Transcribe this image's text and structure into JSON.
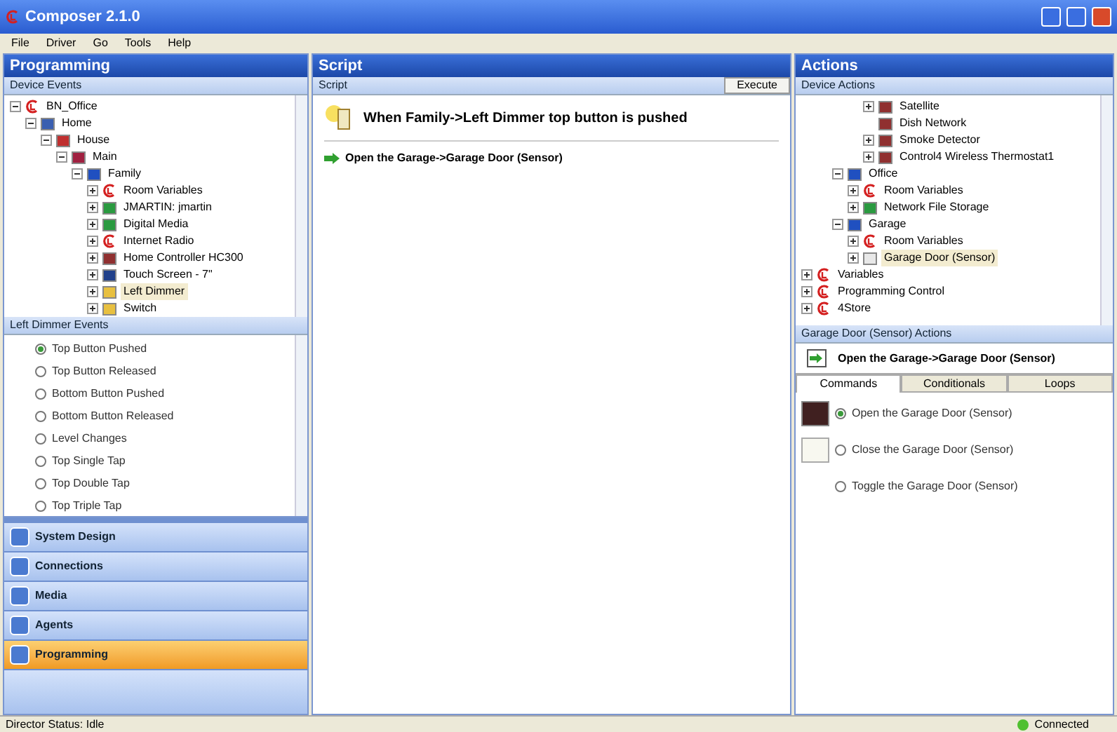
{
  "window": {
    "title": "Composer 2.1.0"
  },
  "menu": [
    "File",
    "Driver",
    "Go",
    "Tools",
    "Help"
  ],
  "programming": {
    "title": "Programming",
    "events_header": "Device Events",
    "tree": [
      {
        "label": "BN_Office",
        "kind": "logo",
        "expanded": true,
        "selected": false,
        "children": [
          {
            "label": "Home",
            "kind": "home",
            "expanded": true,
            "selected": false,
            "children": [
              {
                "label": "House",
                "kind": "house",
                "expanded": true,
                "selected": false,
                "children": [
                  {
                    "label": "Main",
                    "kind": "floor",
                    "expanded": true,
                    "selected": false,
                    "children": [
                      {
                        "label": "Family",
                        "kind": "room",
                        "expanded": true,
                        "selected": false,
                        "children": [
                          {
                            "label": "Room Variables",
                            "kind": "logo",
                            "expanded": false,
                            "selected": false
                          },
                          {
                            "label": "JMARTIN: jmartin",
                            "kind": "user",
                            "expanded": false,
                            "selected": false
                          },
                          {
                            "label": "Digital Media",
                            "kind": "user",
                            "expanded": false,
                            "selected": false
                          },
                          {
                            "label": "Internet Radio",
                            "kind": "logo",
                            "expanded": false,
                            "selected": false
                          },
                          {
                            "label": "Home Controller HC300",
                            "kind": "device",
                            "expanded": false,
                            "selected": false
                          },
                          {
                            "label": "Touch Screen - 7\"",
                            "kind": "screen",
                            "expanded": false,
                            "selected": false
                          },
                          {
                            "label": "Left Dimmer",
                            "kind": "light",
                            "expanded": false,
                            "selected": true
                          },
                          {
                            "label": "Switch",
                            "kind": "light",
                            "expanded": false,
                            "selected": false
                          }
                        ]
                      }
                    ]
                  }
                ]
              }
            ]
          }
        ]
      }
    ],
    "events_title": "Left Dimmer Events",
    "events": [
      {
        "label": "Top Button Pushed",
        "selected": true
      },
      {
        "label": "Top Button Released",
        "selected": false
      },
      {
        "label": "Bottom Button Pushed",
        "selected": false
      },
      {
        "label": "Bottom Button Released",
        "selected": false
      },
      {
        "label": "Level Changes",
        "selected": false
      },
      {
        "label": "Top Single Tap",
        "selected": false
      },
      {
        "label": "Top Double Tap",
        "selected": false
      },
      {
        "label": "Top Triple Tap",
        "selected": false
      }
    ],
    "nav": [
      {
        "label": "System Design",
        "selected": false
      },
      {
        "label": "Connections",
        "selected": false
      },
      {
        "label": "Media",
        "selected": false
      },
      {
        "label": "Agents",
        "selected": false
      },
      {
        "label": "Programming",
        "selected": true
      }
    ]
  },
  "script": {
    "title": "Script",
    "subheader": "Script",
    "execute": "Execute",
    "when": "When Family->Left Dimmer top button is pushed",
    "steps": [
      "Open the Garage->Garage Door (Sensor)"
    ]
  },
  "actions": {
    "title": "Actions",
    "device_actions": "Device Actions",
    "continued": [
      {
        "label": "Satellite",
        "kind": "device",
        "expanded": false,
        "selected": false
      },
      {
        "label": "Dish Network",
        "kind": "device",
        "selected": false
      },
      {
        "label": "Smoke Detector",
        "kind": "device",
        "expanded": false,
        "selected": false
      },
      {
        "label": "Control4 Wireless Thermostat1",
        "kind": "device",
        "expanded": false,
        "selected": false
      }
    ],
    "rooms": [
      {
        "label": "Office",
        "kind": "room",
        "expanded": true,
        "selected": false,
        "children": [
          {
            "label": "Room Variables",
            "kind": "logo",
            "expanded": false,
            "selected": false
          },
          {
            "label": "Network File Storage",
            "kind": "user",
            "expanded": false,
            "selected": false
          }
        ]
      },
      {
        "label": "Garage",
        "kind": "room",
        "expanded": true,
        "selected": false,
        "children": [
          {
            "label": "Room Variables",
            "kind": "logo",
            "expanded": false,
            "selected": false
          },
          {
            "label": "Garage Door (Sensor)",
            "kind": "door",
            "expanded": false,
            "selected": true
          }
        ]
      }
    ],
    "top": [
      {
        "label": "Variables",
        "kind": "logo",
        "expanded": false,
        "selected": false
      },
      {
        "label": "Programming Control",
        "kind": "logo",
        "expanded": false,
        "selected": false
      },
      {
        "label": "4Store",
        "kind": "logo",
        "expanded": false,
        "selected": false
      }
    ],
    "panel_title": "Garage Door (Sensor) Actions",
    "action_title": "Open the Garage->Garage Door (Sensor)",
    "tabs": [
      {
        "label": "Commands",
        "selected": true
      },
      {
        "label": "Conditionals",
        "selected": false
      },
      {
        "label": "Loops",
        "selected": false
      }
    ],
    "commands": [
      {
        "label": "Open the Garage Door (Sensor)",
        "selected": true,
        "kind": "open"
      },
      {
        "label": "Close the Garage Door (Sensor)",
        "selected": false,
        "kind": "close"
      },
      {
        "label": "Toggle the Garage Door (Sensor)",
        "selected": false,
        "kind": "none"
      }
    ]
  },
  "status_bar": {
    "left": "Director Status: Idle",
    "right": "Connected"
  }
}
